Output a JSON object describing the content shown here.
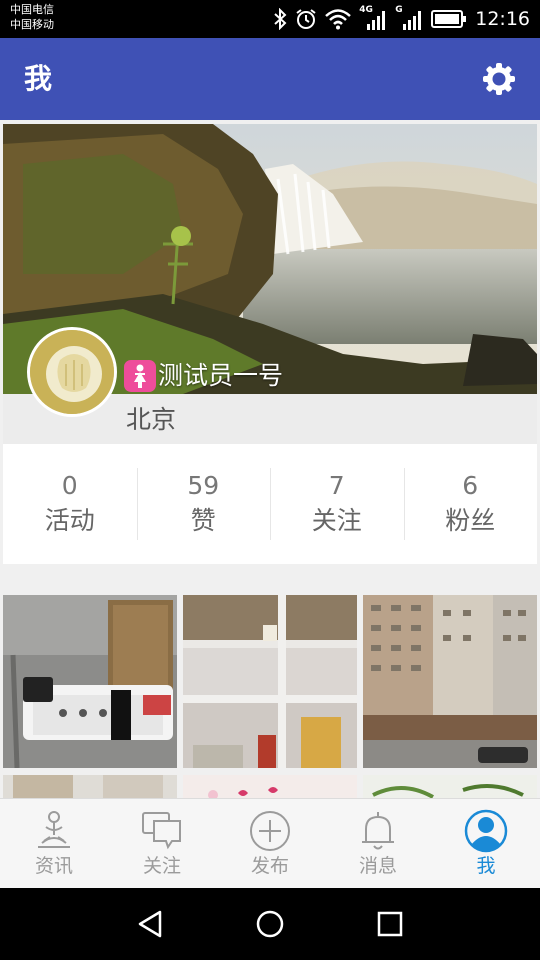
{
  "status_bar": {
    "carrier_1": "中国电信",
    "carrier_2": "中国移动",
    "net_1": "4G",
    "net_2": "G",
    "time": "12:16"
  },
  "app_bar": {
    "title": "我",
    "settings_icon": "gear-icon",
    "color": "#3f51b5"
  },
  "profile": {
    "username": "测试员一号",
    "location": "北京",
    "gender_icon": "female-icon",
    "gender_color": "#ee4d9b"
  },
  "stats": [
    {
      "count": "0",
      "label": "活动"
    },
    {
      "count": "59",
      "label": "赞"
    },
    {
      "count": "7",
      "label": "关注"
    },
    {
      "count": "6",
      "label": "粉丝"
    }
  ],
  "bottom_nav": {
    "active": "我",
    "active_color": "#1a8ad6",
    "items": [
      {
        "label": "资讯",
        "icon": "meditation-icon"
      },
      {
        "label": "关注",
        "icon": "chat-bubbles-icon"
      },
      {
        "label": "发布",
        "icon": "plus-circle-icon"
      },
      {
        "label": "消息",
        "icon": "bell-icon"
      },
      {
        "label": "我",
        "icon": "user-icon"
      }
    ]
  }
}
